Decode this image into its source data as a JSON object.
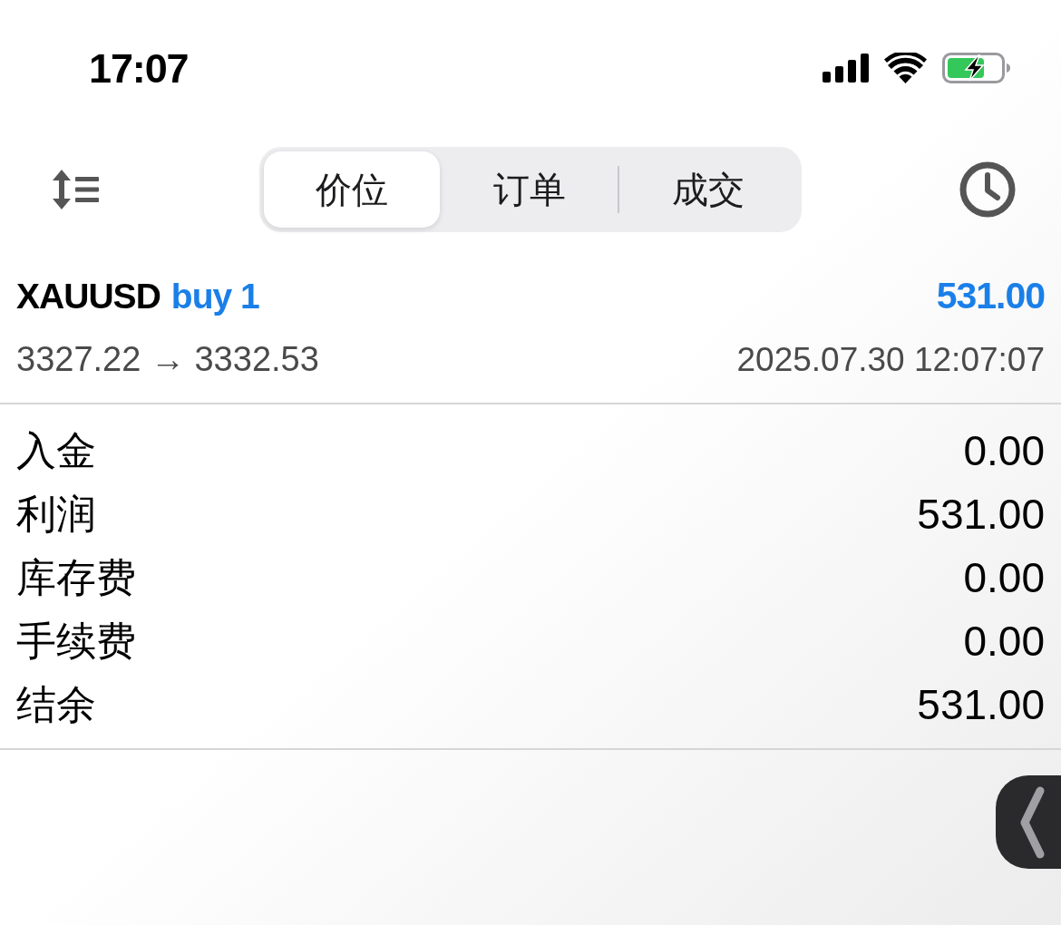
{
  "status_bar": {
    "time": "17:07"
  },
  "toolbar": {
    "segments": [
      {
        "label": "价位",
        "selected": true
      },
      {
        "label": "订单",
        "selected": false
      },
      {
        "label": "成交",
        "selected": false
      }
    ]
  },
  "deal": {
    "symbol": "XAUUSD",
    "side": "buy 1",
    "profit": "531.00",
    "prices": "3327.22 → 3332.53",
    "time": "2025.07.30 12:07:07"
  },
  "summary": [
    {
      "label": "入金",
      "value": "0.00"
    },
    {
      "label": "利润",
      "value": "531.00"
    },
    {
      "label": "库存费",
      "value": "0.00"
    },
    {
      "label": "手续费",
      "value": "0.00"
    },
    {
      "label": "结余",
      "value": "531.00"
    }
  ]
}
